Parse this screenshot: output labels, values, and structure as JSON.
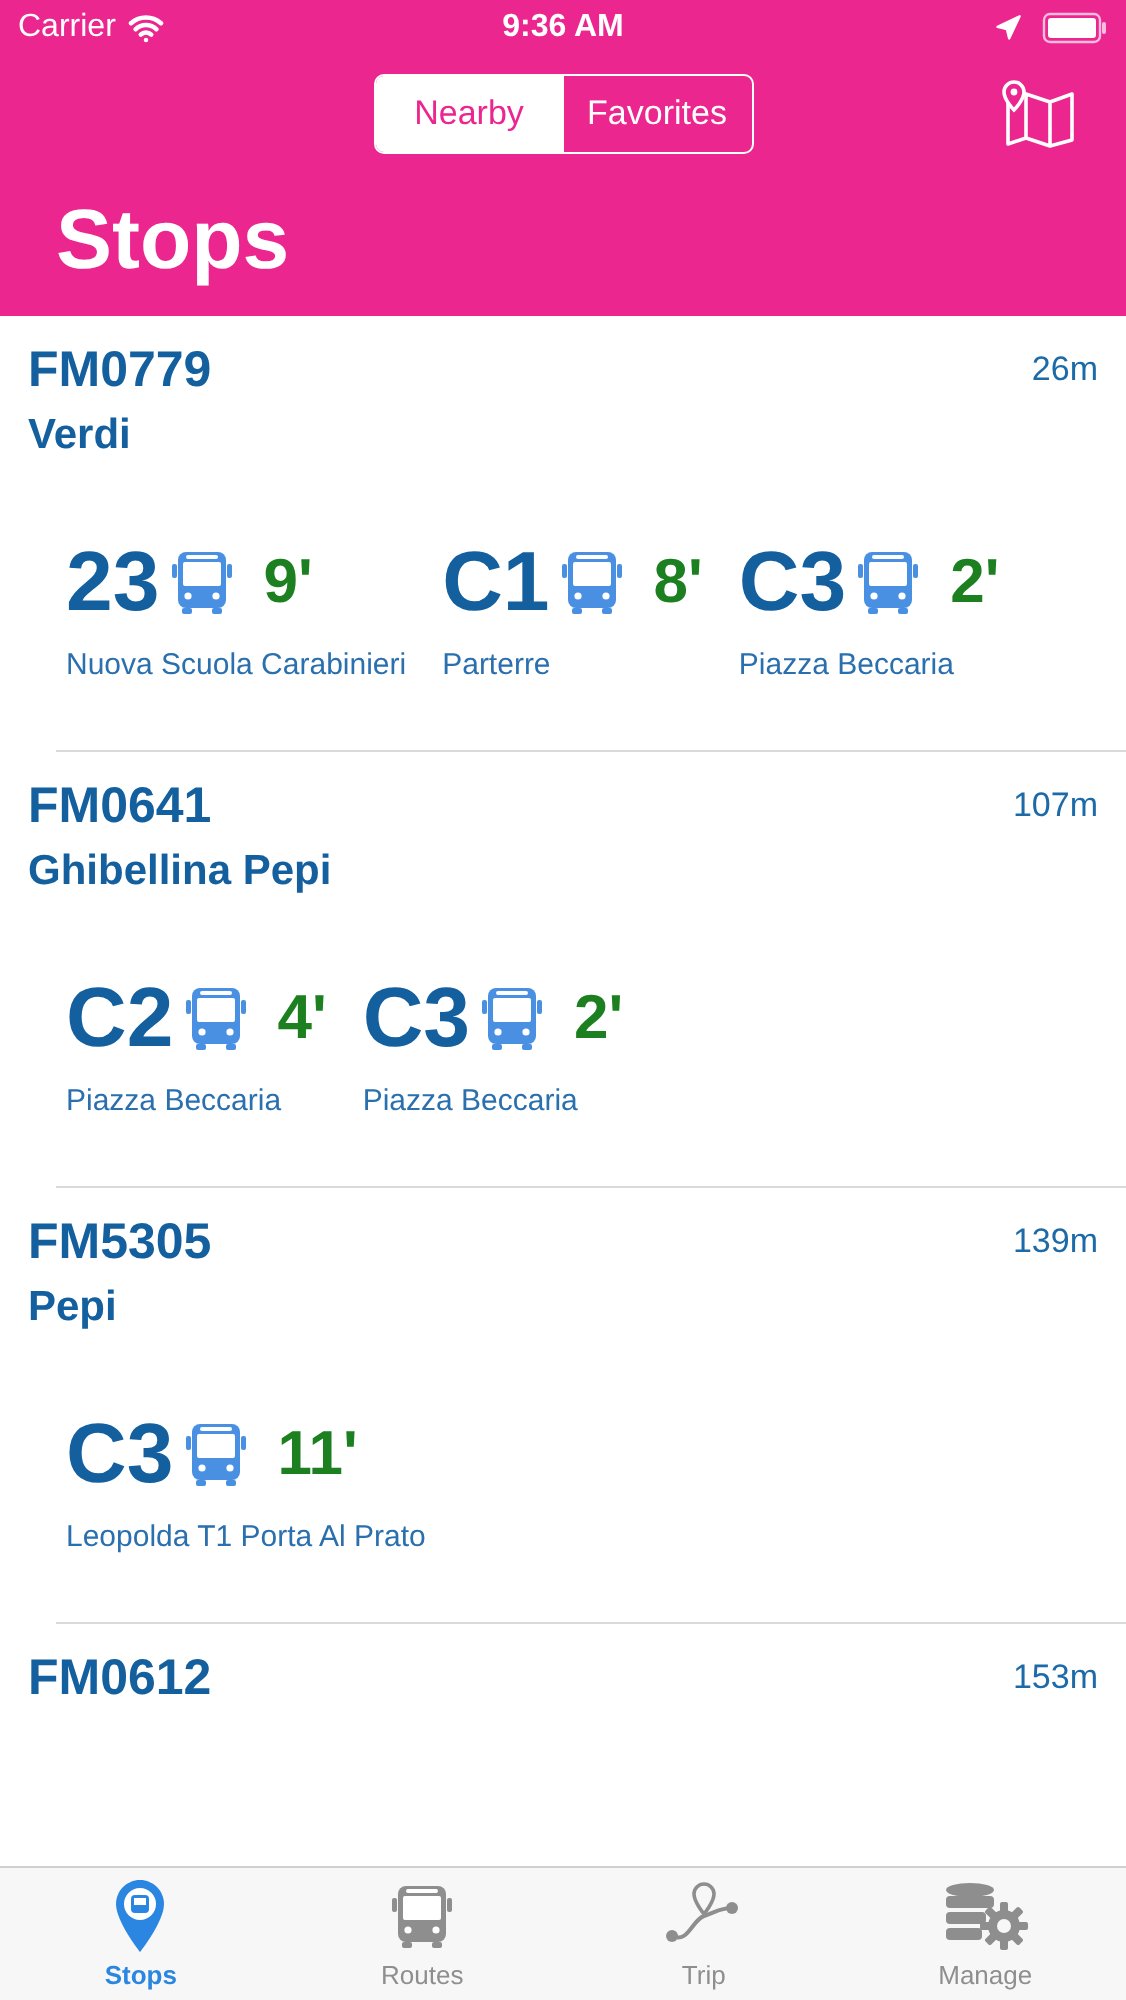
{
  "status_bar": {
    "carrier": "Carrier",
    "time": "9:36 AM"
  },
  "segments": [
    {
      "label": "Nearby",
      "selected": true
    },
    {
      "label": "Favorites",
      "selected": false
    }
  ],
  "title": "Stops",
  "stops": [
    {
      "code": "FM0779",
      "distance": "26m",
      "name": "Verdi",
      "routes": [
        {
          "line": "23",
          "minutes": "9'",
          "destination": "Nuova Scuola Carabinieri"
        },
        {
          "line": "C1",
          "minutes": "8'",
          "destination": "Parterre"
        },
        {
          "line": "C3",
          "minutes": "2'",
          "destination": "Piazza Beccaria"
        }
      ]
    },
    {
      "code": "FM0641",
      "distance": "107m",
      "name": "Ghibellina Pepi",
      "routes": [
        {
          "line": "C2",
          "minutes": "4'",
          "destination": "Piazza Beccaria"
        },
        {
          "line": "C3",
          "minutes": "2'",
          "destination": "Piazza Beccaria"
        }
      ]
    },
    {
      "code": "FM5305",
      "distance": "139m",
      "name": "Pepi",
      "routes": [
        {
          "line": "C3",
          "minutes": "11'",
          "destination": "Leopolda T1 Porta Al Prato"
        }
      ]
    },
    {
      "code": "FM0612",
      "distance": "153m"
    }
  ],
  "tabs": [
    {
      "kind": "stops",
      "label": "Stops",
      "selected": true
    },
    {
      "kind": "routes",
      "label": "Routes",
      "selected": false
    },
    {
      "kind": "trip",
      "label": "Trip",
      "selected": false
    },
    {
      "kind": "manage",
      "label": "Manage",
      "selected": false
    }
  ]
}
